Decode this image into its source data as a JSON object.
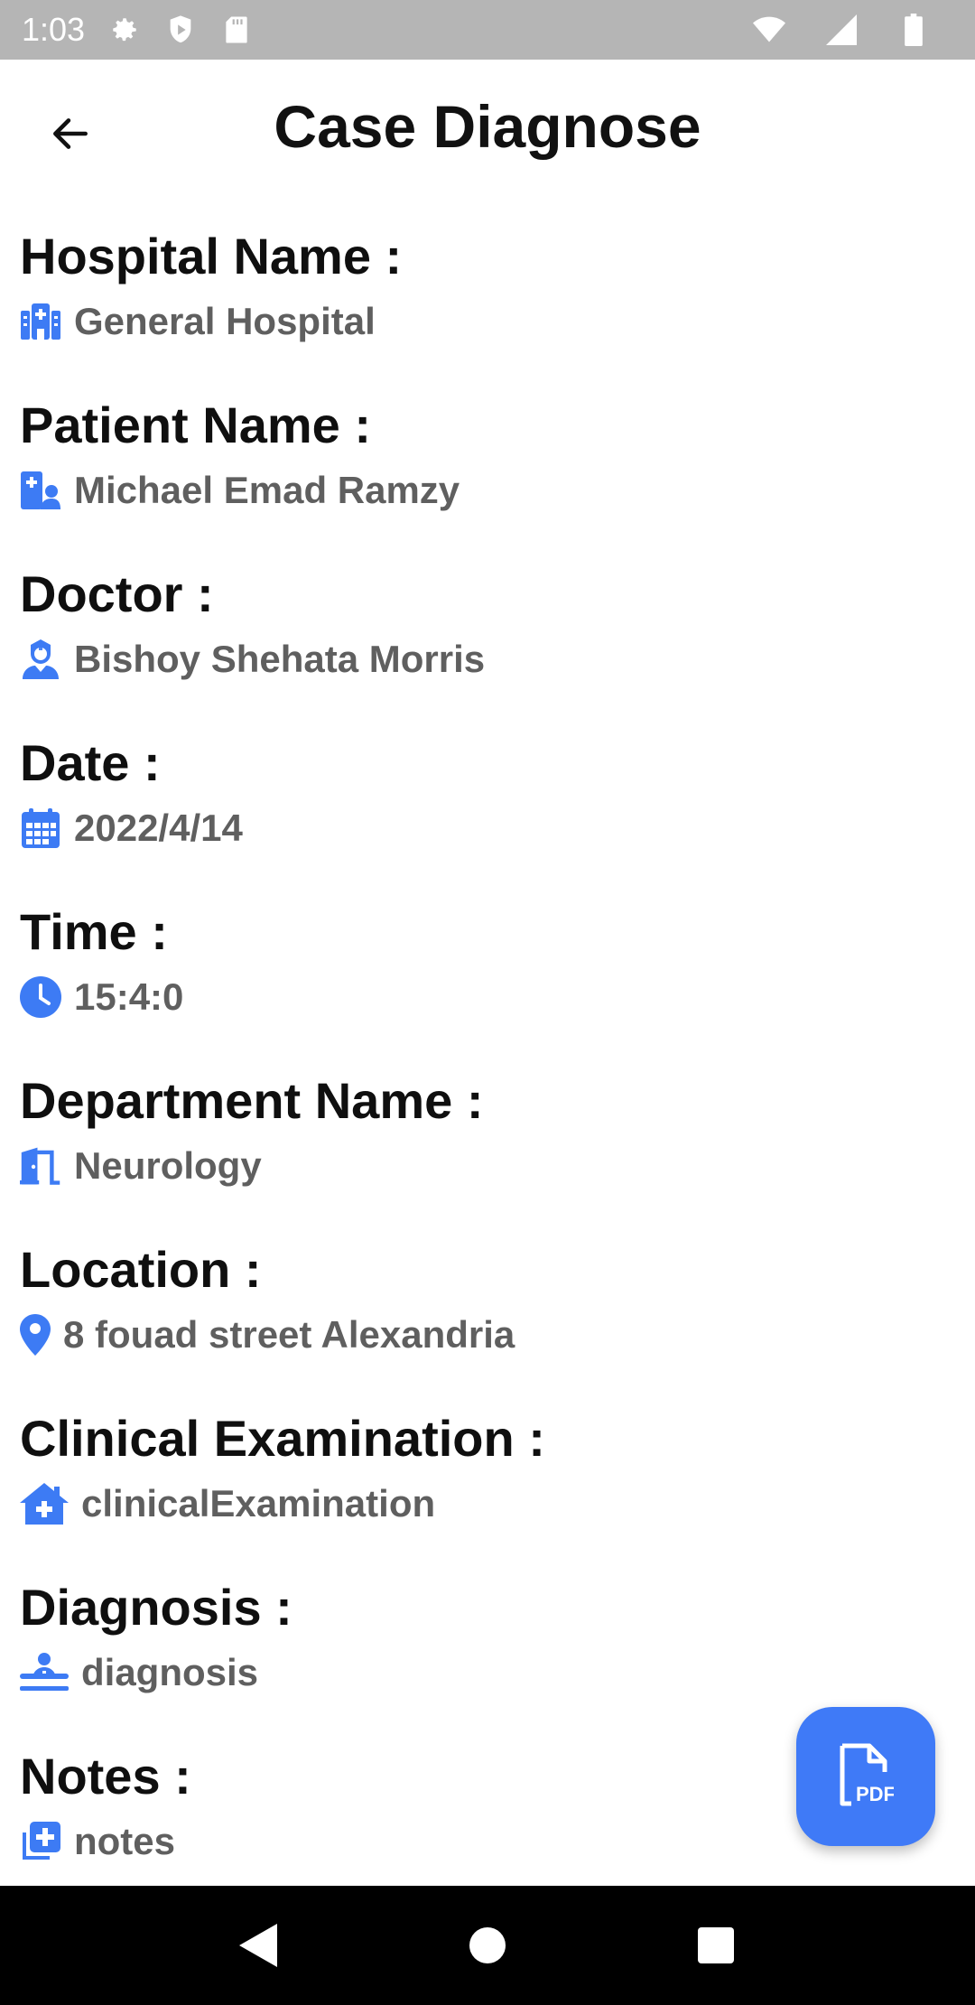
{
  "status_bar": {
    "time": "1:03",
    "icons": [
      "gear-icon",
      "shield-icon",
      "sd-card-icon",
      "wifi-icon",
      "signal-icon",
      "battery-icon"
    ]
  },
  "header": {
    "title": "Case Diagnose",
    "back_icon": "arrow-left-icon"
  },
  "sections": [
    {
      "label": "Hospital Name :",
      "value": "General Hospital",
      "icon": "hospital-icon"
    },
    {
      "label": "Patient Name :",
      "value": "Michael Emad Ramzy",
      "icon": "patient-card-icon"
    },
    {
      "label": "Doctor :",
      "value": "Bishoy Shehata Morris",
      "icon": "doctor-icon"
    },
    {
      "label": "Date :",
      "value": "2022/4/14",
      "icon": "calendar-icon"
    },
    {
      "label": "Time :",
      "value": "15:4:0",
      "icon": "clock-icon"
    },
    {
      "label": "Department Name :",
      "value": "Neurology",
      "icon": "door-icon"
    },
    {
      "label": "Location :",
      "value": "8 fouad street Alexandria",
      "icon": "location-pin-icon"
    },
    {
      "label": "Clinical Examination :",
      "value": "clinicalExamination",
      "icon": "house-medical-icon"
    },
    {
      "label": "Diagnosis :",
      "value": "diagnosis",
      "icon": "patient-bed-icon"
    },
    {
      "label": "Notes :",
      "value": "notes",
      "icon": "notes-plus-icon"
    }
  ],
  "fab": {
    "label": "PDF",
    "icon": "pdf-file-icon"
  },
  "nav": {
    "icons": [
      "back-triangle-icon",
      "home-circle-icon",
      "recents-square-icon"
    ]
  },
  "colors": {
    "accent": "#3f7af7",
    "icon_blue": "#3d7bf4",
    "status_bar": "#b5b5b5",
    "value_text": "#5f5f5f"
  }
}
